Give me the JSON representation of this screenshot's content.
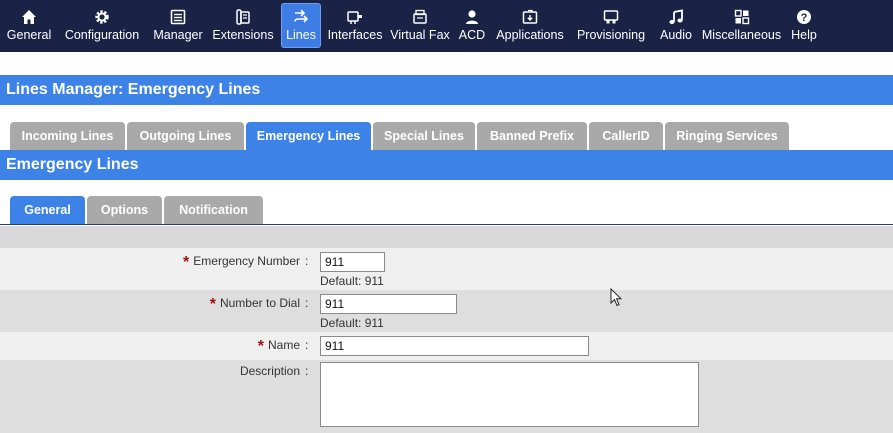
{
  "nav": {
    "items": [
      {
        "label": "General",
        "icon": "home-icon"
      },
      {
        "label": "Configuration",
        "icon": "gear-icon"
      },
      {
        "label": "Manager",
        "icon": "manager-icon"
      },
      {
        "label": "Extensions",
        "icon": "phone-icon"
      },
      {
        "label": "Lines",
        "icon": "lines-icon",
        "active": true
      },
      {
        "label": "Interfaces",
        "icon": "interfaces-icon"
      },
      {
        "label": "Virtual Fax",
        "icon": "fax-icon"
      },
      {
        "label": "ACD",
        "icon": "agent-icon"
      },
      {
        "label": "Applications",
        "icon": "applications-icon"
      },
      {
        "label": "Provisioning",
        "icon": "provisioning-icon"
      },
      {
        "label": "Audio",
        "icon": "music-note-icon"
      },
      {
        "label": "Miscellaneous",
        "icon": "grid-icon"
      },
      {
        "label": "Help",
        "icon": "help-icon"
      }
    ]
  },
  "page": {
    "title": "Lines Manager:  Emergency Lines",
    "section_title": "Emergency Lines"
  },
  "line_tabs": [
    {
      "label": "Incoming Lines"
    },
    {
      "label": "Outgoing Lines"
    },
    {
      "label": "Emergency Lines",
      "active": true
    },
    {
      "label": "Special Lines"
    },
    {
      "label": "Banned Prefix"
    },
    {
      "label": "CallerID"
    },
    {
      "label": "Ringing Services"
    }
  ],
  "sub_tabs": [
    {
      "label": "General",
      "active": true
    },
    {
      "label": "Options"
    },
    {
      "label": "Notification"
    }
  ],
  "form": {
    "required_mark": "*",
    "separator": ":",
    "emergency_number": {
      "label": "Emergency Number",
      "value": "911",
      "hint": "Default: 911"
    },
    "number_to_dial": {
      "label": "Number to Dial",
      "value": "911",
      "hint": "Default: 911"
    },
    "name": {
      "label": "Name",
      "value": "911"
    },
    "description": {
      "label": "Description",
      "value": ""
    }
  },
  "colors": {
    "nav_background": "#1a2246",
    "accent_blue": "#3d82e6",
    "tab_inactive": "#a9a9a9",
    "required_red": "#a01010"
  }
}
